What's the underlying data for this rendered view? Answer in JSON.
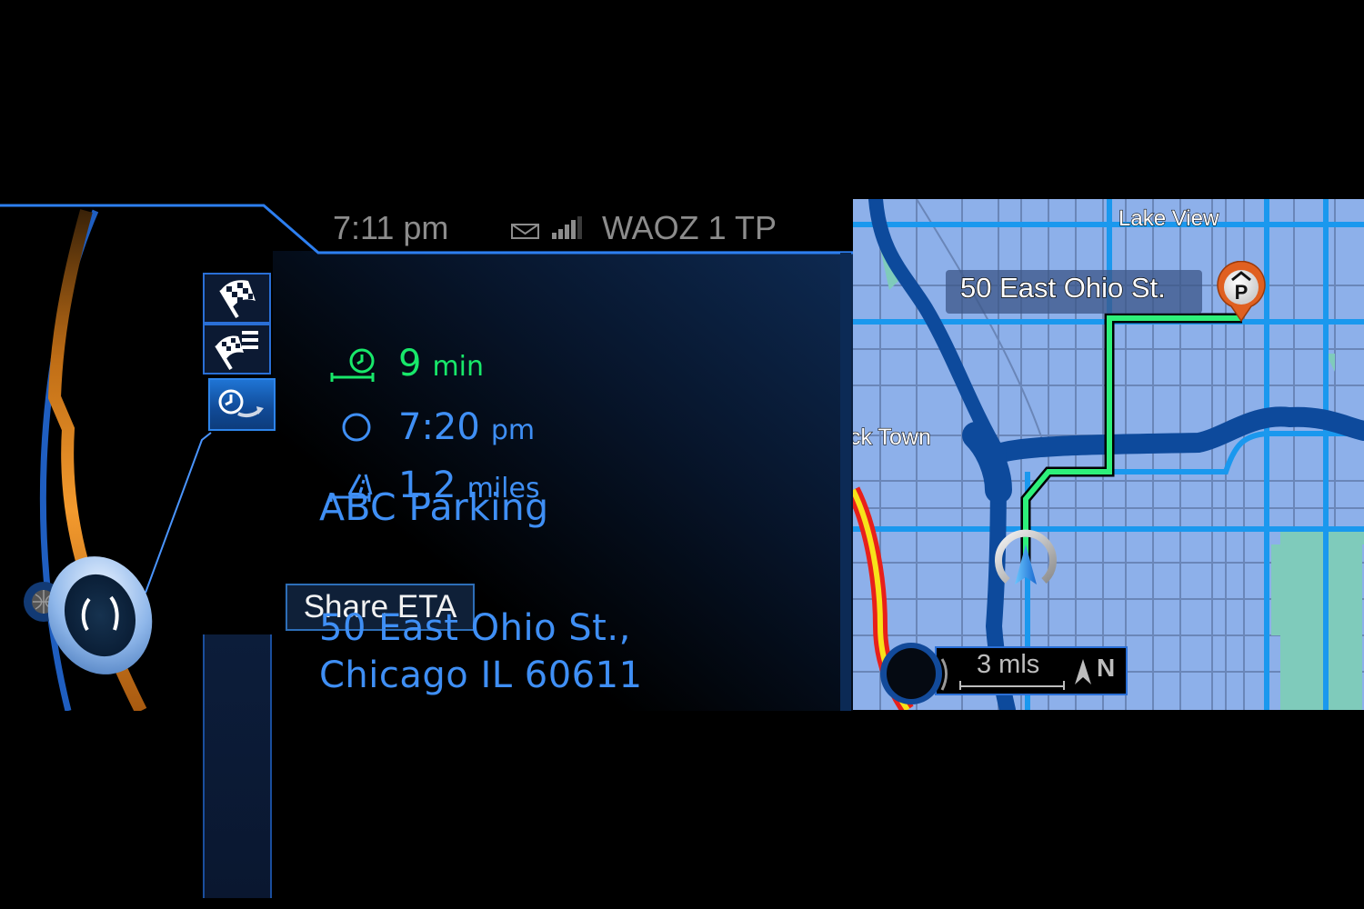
{
  "status_bar": {
    "time": "7:11 pm",
    "message_icon": "envelope-icon",
    "signal_icon": "signal-bars-icon",
    "signal_bars_active": 4,
    "signal_bars_total": 5,
    "station": "WAOZ 1 TP"
  },
  "side_menu": {
    "items": [
      {
        "icon": "checkered-flag-icon",
        "label": "Destination"
      },
      {
        "icon": "checkered-flag-list-icon",
        "label": "Route list"
      },
      {
        "icon": "clock-share-icon",
        "label": "Share ETA",
        "active": true
      }
    ],
    "tooltip": "Share ETA"
  },
  "destination": {
    "name": "ABC Parking",
    "travel_time": {
      "value": "9",
      "unit": "min",
      "icon": "travel-time-icon"
    },
    "arrival_time": {
      "value": "7:20",
      "unit": "pm",
      "icon": "arrival-clock-icon"
    },
    "distance": {
      "value": "1.2",
      "unit": "miles",
      "icon": "road-distance-icon"
    },
    "address_line1": "50 East Ohio St.,",
    "address_line2": "Chicago IL  60611"
  },
  "map": {
    "area_labels": [
      "Lake View",
      "ck Town"
    ],
    "destination_label": "50 East Ohio St.",
    "poi_icon": "parking-pin-icon",
    "poi_letter": "P",
    "vehicle_icon": "vehicle-arrow-icon",
    "scale": "3 mls",
    "north_label": "N",
    "compass_icon": "north-arrow-icon"
  },
  "controller": {
    "icon": "idrive-controller-icon",
    "globe_icon": "globe-icon"
  },
  "colors": {
    "accent_blue": "#3f8ff5",
    "frame_blue": "#2a6fd6",
    "eta_green": "#18e86a",
    "route_green": "#2ef07a",
    "map_base": "#8db0ea",
    "river": "#0d4a9c",
    "highway_red": "#e8201a",
    "highway_yellow": "#f7e21a",
    "parking_orange": "#e06020"
  }
}
